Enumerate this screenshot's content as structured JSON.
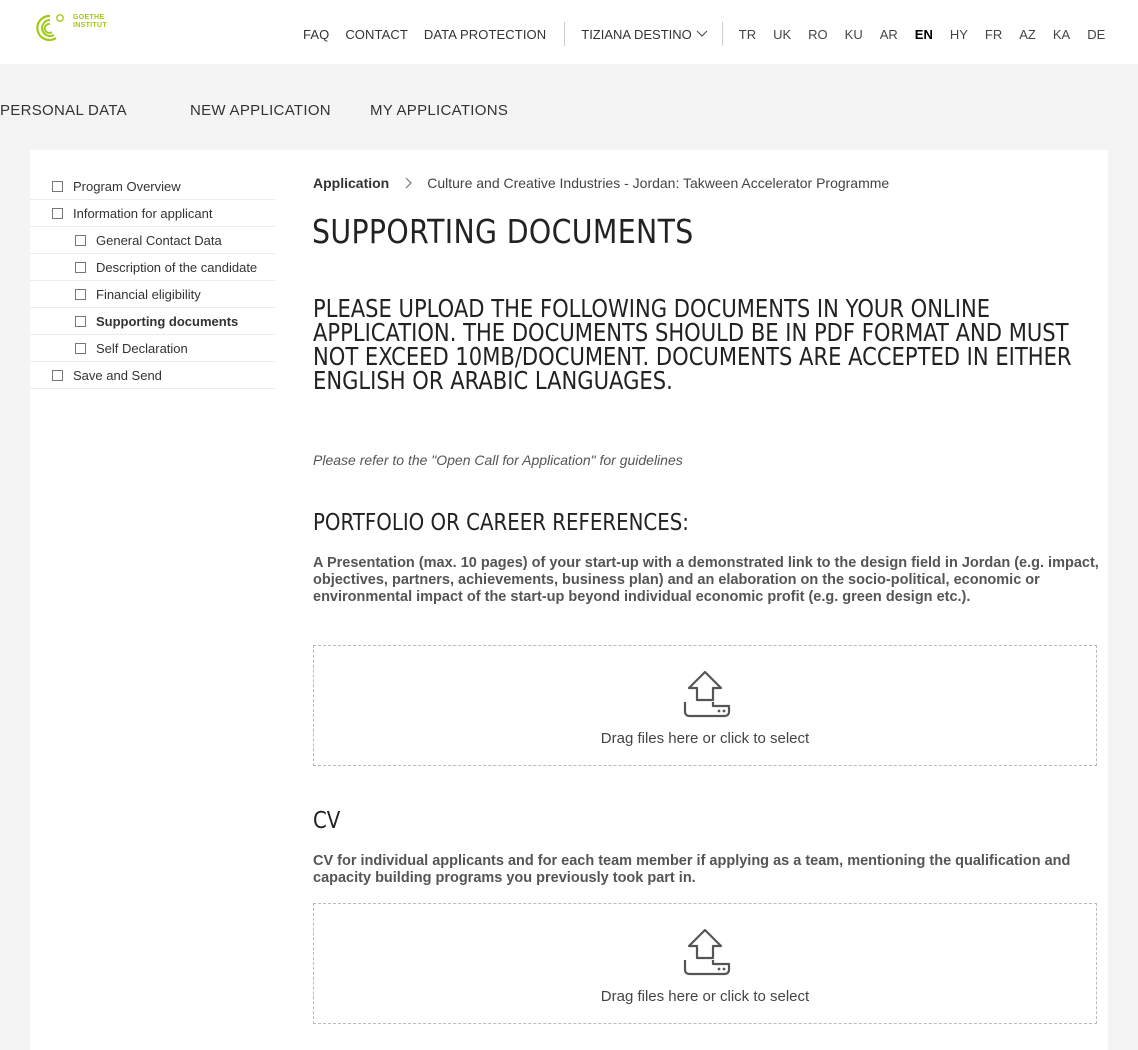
{
  "brand": {
    "logo_line1": "GOETHE",
    "logo_line2": "INSTITUT",
    "color": "#a0c814"
  },
  "topnav": {
    "links": [
      "FAQ",
      "CONTACT",
      "DATA PROTECTION"
    ],
    "user": "TIZIANA DESTINO",
    "languages": [
      "TR",
      "UK",
      "RO",
      "KU",
      "AR",
      "EN",
      "HY",
      "FR",
      "AZ",
      "KA",
      "DE"
    ],
    "active_language": "EN"
  },
  "mainnav": [
    "PERSONAL DATA",
    "NEW APPLICATION",
    "MY APPLICATIONS"
  ],
  "sidebar": {
    "items": [
      {
        "label": "Program Overview",
        "level": 1
      },
      {
        "label": "Information for applicant",
        "level": 1
      },
      {
        "label": "General Contact Data",
        "level": 2
      },
      {
        "label": "Description of the candidate",
        "level": 2
      },
      {
        "label": "Financial eligibility",
        "level": 2
      },
      {
        "label": "Supporting documents",
        "level": 2,
        "active": true
      },
      {
        "label": "Self Declaration",
        "level": 2
      },
      {
        "label": "Save and Send",
        "level": 1
      }
    ]
  },
  "breadcrumb": {
    "root": "Application",
    "current": "Culture and Creative Industries - Jordan: Takween Accelerator Programme"
  },
  "page_title": "SUPPORTING DOCUMENTS",
  "intro": "PLEASE UPLOAD THE FOLLOWING DOCUMENTS IN YOUR ONLINE APPLICATION. THE DOCUMENTS SHOULD BE IN PDF FORMAT AND MUST NOT EXCEED 10MB/DOCUMENT. DOCUMENTS ARE ACCEPTED IN EITHER ENGLISH OR ARABIC LANGUAGES.",
  "note": "Please refer to the \"Open Call for Application\" for guidelines",
  "sections": [
    {
      "title": "PORTFOLIO OR CAREER REFERENCES:",
      "description": "A Presentation (max. 10 pages) of your start-up with a demonstrated link to the design field in Jordan (e.g. impact, objectives, partners, achievements, business plan) and an elaboration on the socio-political, economic or environmental impact of the start-up beyond individual economic profit (e.g. green design etc.).",
      "dropzone_text": "Drag files here or click to select"
    },
    {
      "title": "CV",
      "description": "CV for individual applicants and for each team member if applying as a team, mentioning the qualification and capacity building programs you previously took part in.",
      "dropzone_text": "Drag files here or click to select"
    }
  ]
}
